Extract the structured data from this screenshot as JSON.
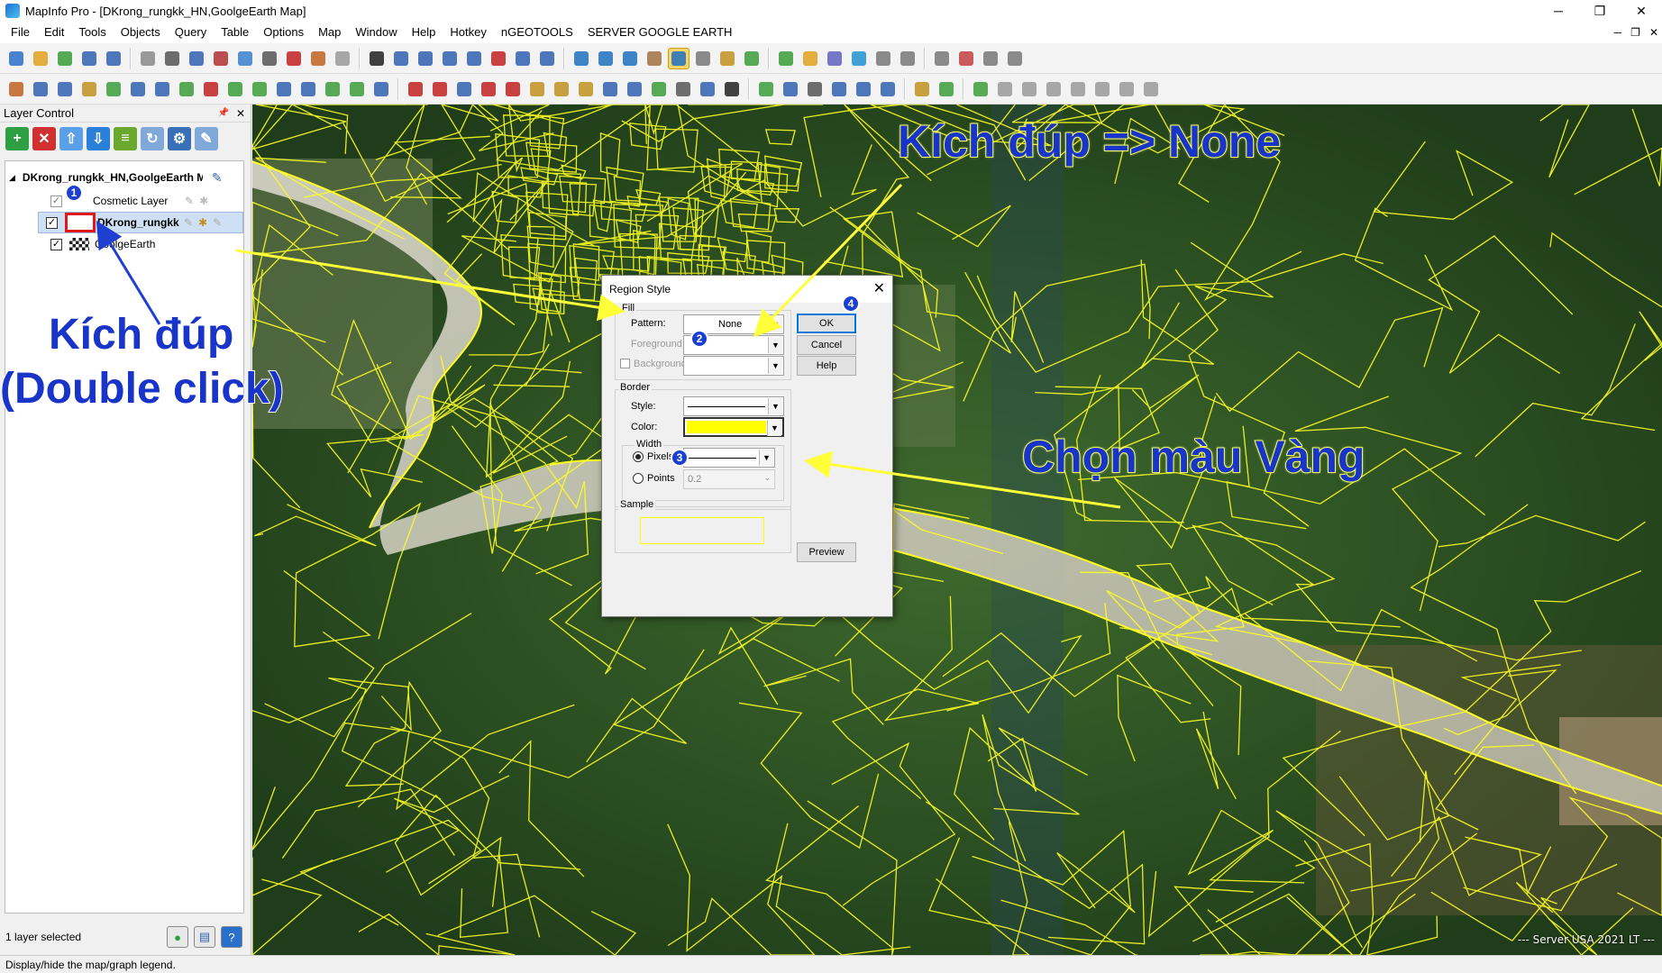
{
  "window": {
    "title": "MapInfo Pro - [DKrong_rungkk_HN,GoolgeEarth Map]",
    "minimize": "─",
    "restore": "❐",
    "close": "✕"
  },
  "menu": {
    "items": [
      "File",
      "Edit",
      "Tools",
      "Objects",
      "Query",
      "Table",
      "Options",
      "Map",
      "Window",
      "Help",
      "Hotkey",
      "nGEOTOOLS",
      "SERVER GOOGLE EARTH"
    ],
    "mdi_minimize": "─",
    "mdi_restore": "❐",
    "mdi_close": "✕"
  },
  "toolbar1": {
    "icons": [
      "new-icon",
      "open-icon",
      "open-workspace-icon",
      "save-icon",
      "save-as-icon",
      "close-table-icon",
      "print-icon",
      "save-copy-icon",
      "open-dbms-icon",
      "new-browser-icon",
      "print-preview-icon",
      "pdf-icon",
      "export-icon",
      "cut-icon",
      "select-icon",
      "marquee-select-icon",
      "radius-select-icon",
      "polygon-select-icon",
      "boundary-select-icon",
      "unselect-icon",
      "invert-select-icon",
      "graph-select-icon",
      "zoom-in-icon",
      "zoom-out-icon",
      "change-view-icon",
      "pan-icon",
      "info-icon",
      "hotlink-icon",
      "label-icon",
      "drag-map-icon",
      "layer-control-icon",
      "ruler-icon",
      "legend-icon",
      "statistics-icon",
      "clip-region-icon",
      "reshape-icon",
      "setup-icon",
      "map-tool-icon",
      "tool-options-icon",
      "scale-icon"
    ],
    "colors": [
      "#2a6fc9",
      "#e0a020",
      "#3a9c3a",
      "#3060b0",
      "#3060b0",
      "#888888",
      "#555555",
      "#3060b0",
      "#b03030",
      "#3a7fd0",
      "#555555",
      "#c02020",
      "#c06020",
      "#999999",
      "#202020",
      "#3060b0",
      "#3060b0",
      "#3060b0",
      "#3060b0",
      "#c02020",
      "#3060b0",
      "#3060b0",
      "#2070c0",
      "#2070c0",
      "#2070c0",
      "#a07040",
      "#2070c0",
      "#777777",
      "#c09020",
      "#3a9c3a",
      "#3a9c3a",
      "#e0a020",
      "#6060c0",
      "#2090d0",
      "#777777",
      "#777777",
      "#777777",
      "#c04040",
      "#777777",
      "#777777"
    ]
  },
  "toolbar2": {
    "icons": [
      "symbol-icon",
      "line-icon",
      "polyline-icon",
      "arc-icon",
      "polygon-icon",
      "ellipse-icon",
      "rectangle-icon",
      "rounded-rect-icon",
      "text-icon",
      "frame-icon",
      "reshape-icon",
      "add-node-icon",
      "symbol-style-icon",
      "line-style-icon",
      "region-style-icon",
      "text-style-icon",
      "flag-icon",
      "triangle-icon",
      "grid-icon",
      "mountain-icon",
      "mountain2-icon",
      "hammer-icon",
      "combine-icon",
      "split-icon",
      "erase-icon",
      "buffer-icon",
      "measure-icon",
      "angle-icon",
      "coord-icon",
      "text-tool-icon",
      "globe-icon",
      "node-icon",
      "curve-icon",
      "label-xy-icon",
      "crop-icon",
      "xy-text-icon",
      "table-icon",
      "sphere-icon",
      "toggle-icon",
      "disk-icon",
      "world-icon",
      "hatch-icon",
      "stack-icon",
      "pencil-icon",
      "house-icon",
      "cross-icon"
    ],
    "colors": [
      "#c06020",
      "#3060b0",
      "#3060b0",
      "#c09020",
      "#3a9c3a",
      "#3060b0",
      "#3060b0",
      "#3a9c3a",
      "#c02020",
      "#3a9c3a",
      "#3a9c3a",
      "#3060b0",
      "#3060b0",
      "#3a9c3a",
      "#3a9c3a",
      "#3060b0",
      "#c02020",
      "#c02020",
      "#3060b0",
      "#c02020",
      "#c02020",
      "#c09020",
      "#c09020",
      "#c09020",
      "#3060b0",
      "#3060b0",
      "#3a9c3a",
      "#555555",
      "#3060b0",
      "#202020",
      "#3a9c3a",
      "#3060b0",
      "#555555",
      "#3060b0",
      "#3060b0",
      "#3060b0",
      "#c09020",
      "#3a9c3a",
      "#3a9c3a",
      "#999999",
      "#999999",
      "#999999",
      "#999999",
      "#999999",
      "#999999",
      "#999999"
    ]
  },
  "layer_control": {
    "title": "Layer Control",
    "pin": "📌",
    "close": "✕",
    "toolbar": [
      {
        "name": "add-layer-icon",
        "glyph": "+",
        "color": "#2ea043"
      },
      {
        "name": "remove-layer-icon",
        "glyph": "✕",
        "color": "#d13030"
      },
      {
        "name": "move-up-icon",
        "glyph": "⇧",
        "color": "#5aa0e8"
      },
      {
        "name": "move-down-icon",
        "glyph": "⇩",
        "color": "#2a7fd8"
      },
      {
        "name": "layer-stack-icon",
        "glyph": "≡",
        "color": "#6aa830"
      },
      {
        "name": "layer-refresh-icon",
        "glyph": "↻",
        "color": "#80a8d8"
      },
      {
        "name": "layer-properties-icon",
        "glyph": "⚙",
        "color": "#3a70b8"
      },
      {
        "name": "layer-edit-icon",
        "glyph": "✎",
        "color": "#80a8d8"
      }
    ],
    "map_name": "DKrong_rungkk_HN,GoolgeEarth M",
    "layers": [
      {
        "name": "Cosmetic Layer",
        "checked": true
      },
      {
        "name": "DKrong_rungkk",
        "checked": true,
        "selected": true
      },
      {
        "name": "GoolgeEarth",
        "checked": true
      }
    ],
    "status": "1 layer selected"
  },
  "map": {
    "server_label": "--- Server USA 2021 LT ---"
  },
  "statusbar": {
    "text": "Display/hide the map/graph legend."
  },
  "dialog": {
    "title": "Region Style",
    "fill_legend": "Fill",
    "pattern_label": "Pattern:",
    "pattern_value": "None",
    "foreground_label": "Foreground:",
    "background_label": "Background:",
    "border_legend": "Border",
    "style_label": "Style:",
    "color_label": "Color:",
    "border_color": "#ffff00",
    "width_legend": "Width",
    "pixels_label": "Pixels",
    "points_label": "Points",
    "points_value": "0.2",
    "sample_legend": "Sample",
    "ok": "OK",
    "cancel": "Cancel",
    "help": "Help",
    "preview": "Preview"
  },
  "annotations": {
    "badges": [
      "1",
      "2",
      "3",
      "4"
    ],
    "double_click_1": "Kích đúp",
    "double_click_2": "(Double click)",
    "double_click_none": "Kích đúp => None",
    "choose_yellow": "Chọn màu Vàng",
    "text_color": "#1934c8",
    "arrow_yellow": "#ffff3a",
    "arrow_blue": "#1f3fd0"
  }
}
